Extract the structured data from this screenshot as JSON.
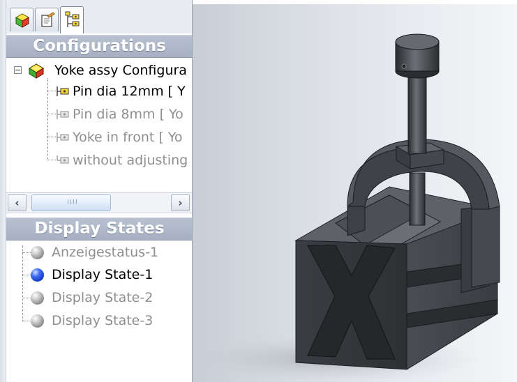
{
  "tabs": [
    {
      "name": "feature-manager",
      "icon": "feature-manager-icon"
    },
    {
      "name": "property-manager",
      "icon": "property-manager-icon"
    },
    {
      "name": "configuration-manager",
      "icon": "configuration-manager-icon",
      "active": true
    }
  ],
  "configurations": {
    "header": "Configurations",
    "root": {
      "label": "Yoke assy Configura",
      "icon": "assembly-icon",
      "expander": "⊟"
    },
    "items": [
      {
        "label": "Pin dia 12mm [ Y",
        "active": true,
        "icon": "configuration-icon"
      },
      {
        "label": "Pin dia 8mm [ Yo",
        "active": false,
        "icon": "configuration-icon"
      },
      {
        "label": "Yoke in front [ Yo",
        "active": false,
        "icon": "configuration-icon"
      },
      {
        "label": "without adjusting",
        "active": false,
        "icon": "configuration-icon"
      }
    ]
  },
  "scrollbar": {
    "left_arrow": "‹",
    "right_arrow": "›",
    "grip": "IIII"
  },
  "display_states": {
    "header": "Display States",
    "items": [
      {
        "label": "Anzeigestatus-1",
        "active": false
      },
      {
        "label": "Display State-1",
        "active": true
      },
      {
        "label": "Display State-2",
        "active": false
      },
      {
        "label": "Display State-3",
        "active": false
      }
    ]
  },
  "model": {
    "description": "V-block with yoke clamp and pin",
    "body_color": "#3d3f44"
  }
}
